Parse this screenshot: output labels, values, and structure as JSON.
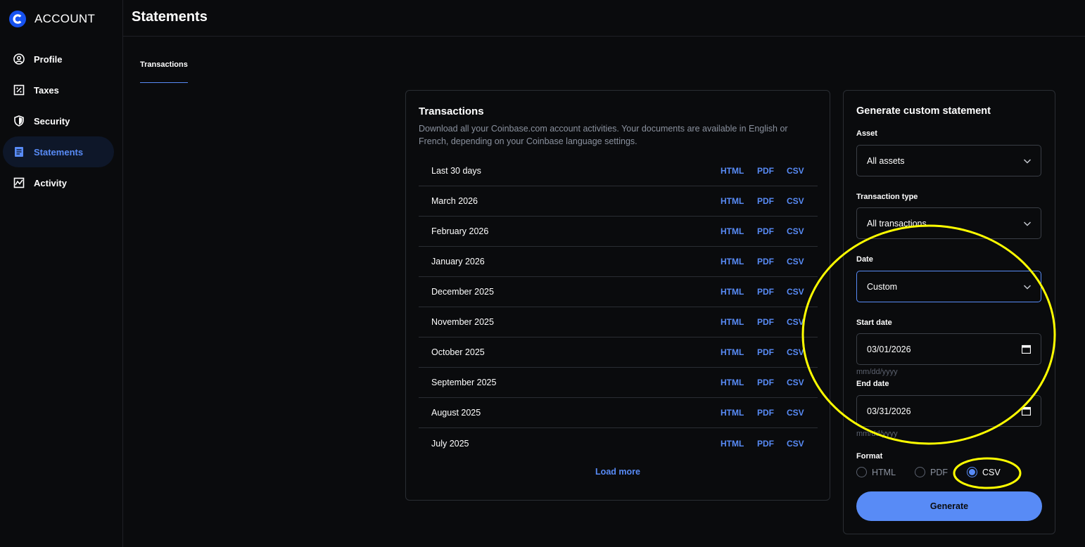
{
  "sidebar": {
    "brand": "ACCOUNT",
    "items": [
      {
        "label": "Profile",
        "icon": "profile-icon"
      },
      {
        "label": "Taxes",
        "icon": "taxes-icon"
      },
      {
        "label": "Security",
        "icon": "shield-icon"
      },
      {
        "label": "Statements",
        "icon": "statements-icon",
        "active": true
      },
      {
        "label": "Activity",
        "icon": "activity-icon"
      }
    ]
  },
  "header": {
    "title": "Statements"
  },
  "tabs": [
    {
      "label": "Transactions",
      "active": true
    }
  ],
  "transactions": {
    "title": "Transactions",
    "description": "Download all your Coinbase.com account activities. Your documents are available in English or French, depending on your Coinbase language settings.",
    "rows": [
      {
        "label": "Last 30 days"
      },
      {
        "label": "March 2026"
      },
      {
        "label": "February 2026"
      },
      {
        "label": "January 2026"
      },
      {
        "label": "December 2025"
      },
      {
        "label": "November 2025"
      },
      {
        "label": "October 2025"
      },
      {
        "label": "September 2025"
      },
      {
        "label": "August 2025"
      },
      {
        "label": "July 2025"
      }
    ],
    "link_html": "HTML",
    "link_pdf": "PDF",
    "link_csv": "CSV",
    "load_more": "Load more"
  },
  "custom": {
    "title": "Generate custom statement",
    "asset_label": "Asset",
    "asset_value": "All assets",
    "type_label": "Transaction type",
    "type_value": "All transactions",
    "date_label": "Date",
    "date_value": "Custom",
    "start_label": "Start date",
    "start_value": "03/01/2026",
    "start_hint": "mm/dd/yyyy",
    "end_label": "End date",
    "end_value": "03/31/2026",
    "end_hint": "mm/dd/yyyy",
    "format_label": "Format",
    "formats": [
      {
        "label": "HTML",
        "checked": false
      },
      {
        "label": "PDF",
        "checked": false
      },
      {
        "label": "CSV",
        "checked": true
      }
    ],
    "generate": "Generate"
  },
  "colors": {
    "background": "#0a0b0d",
    "accent": "#588bf6",
    "annotation": "#ffff00"
  }
}
